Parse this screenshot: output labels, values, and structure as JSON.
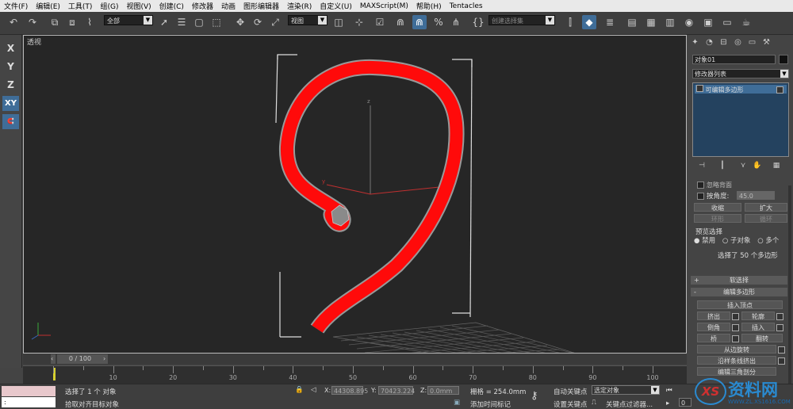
{
  "menu": [
    "文件(F)",
    "编辑(E)",
    "工具(T)",
    "组(G)",
    "视图(V)",
    "创建(C)",
    "修改器",
    "动画",
    "图形编辑器",
    "渲染(R)",
    "自定义(U)",
    "MAXScript(M)",
    "帮助(H)",
    "Tentacles"
  ],
  "toolbar": {
    "selection_filter": "全部",
    "ref_coord": "视图",
    "named_selection_placeholder": "创建选择集"
  },
  "left_toolbar": [
    "X",
    "Y",
    "Z",
    "XY",
    "XY"
  ],
  "viewport": {
    "label": "透视",
    "axis_labels": {
      "x": "x",
      "y": "y",
      "z": "z"
    }
  },
  "command_panel": {
    "object_name": "对象01",
    "modifier_list": "修改器列表",
    "stack_item": "可编辑多边形",
    "angle_label": "按角度:",
    "angle_value": "45.0",
    "partial_top": "忽略背面",
    "shrink": "收缩",
    "grow": "扩大",
    "ring": "环形",
    "loop": "循环",
    "preview_title": "预览选择",
    "preview_options": [
      "禁用",
      "子对象",
      "多个"
    ],
    "selected_info": "选择了 50 个多边形",
    "soft_selection": "软选择",
    "edit_polygons": "编辑多边形",
    "insert_vertex": "插入顶点",
    "extrude": "挤出",
    "outline": "轮廓",
    "bevel": "倒角",
    "inset": "插入",
    "bridge": "桥",
    "flip": "翻转",
    "hinge": "从边旋转",
    "extrude_spline": "沿样条线挤出",
    "edit_tri": "编辑三角剖分"
  },
  "timeline": {
    "slider": "0 / 100",
    "ticks": [
      "10",
      "20",
      "30",
      "40",
      "50",
      "60",
      "70",
      "80",
      "90",
      "100"
    ]
  },
  "status": {
    "selected": "选择了 1 个 对象",
    "prompt": "拾取对齐目标对象",
    "x": "44308.895",
    "y": "70423.224",
    "z": "0.0mm",
    "grid": "栅格 = 254.0mm",
    "auto_key": "自动关键点",
    "selected_filter": "选定对象",
    "set_key": "设置关键点",
    "key_filters": "关键点过滤器...",
    "add_time_tag": "添加时间标记",
    "frame": "0"
  },
  "watermark": "资料网",
  "watermark_url": "WWW.ZL.XS1616.COM",
  "colors": {
    "accent": "#3f6d98",
    "shape": "#ff0a0a",
    "viewport_bg": "#262626"
  }
}
